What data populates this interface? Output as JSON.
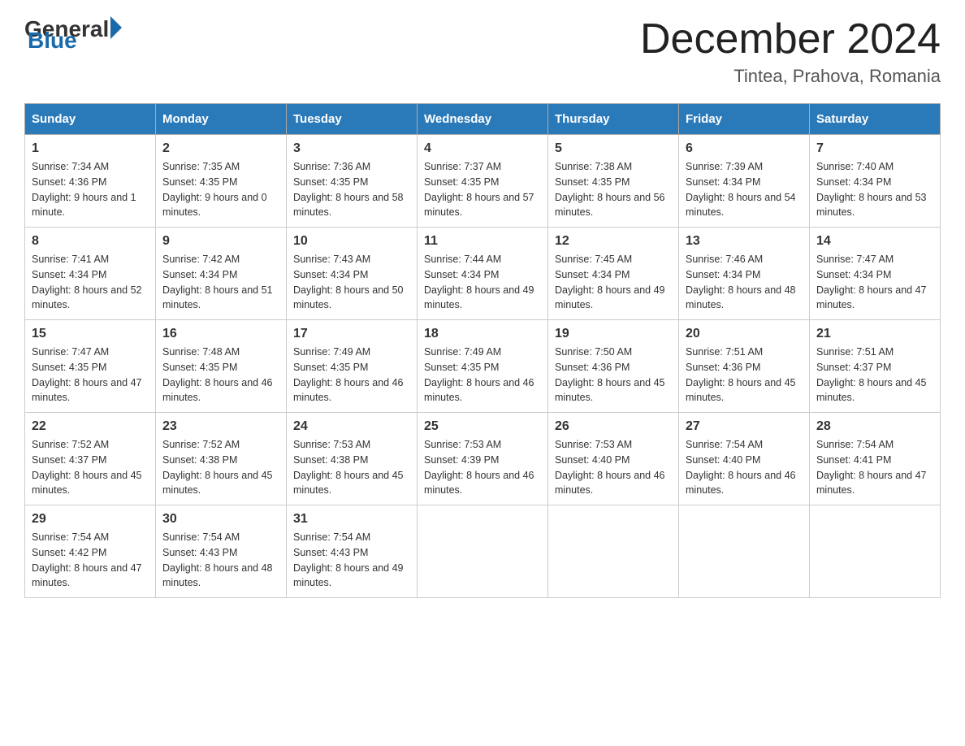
{
  "header": {
    "logo": {
      "general": "General",
      "blue": "Blue"
    },
    "title": "December 2024",
    "location": "Tintea, Prahova, Romania"
  },
  "weekdays": [
    "Sunday",
    "Monday",
    "Tuesday",
    "Wednesday",
    "Thursday",
    "Friday",
    "Saturday"
  ],
  "weeks": [
    [
      {
        "day": "1",
        "sunrise": "7:34 AM",
        "sunset": "4:36 PM",
        "daylight": "9 hours and 1 minute."
      },
      {
        "day": "2",
        "sunrise": "7:35 AM",
        "sunset": "4:35 PM",
        "daylight": "9 hours and 0 minutes."
      },
      {
        "day": "3",
        "sunrise": "7:36 AM",
        "sunset": "4:35 PM",
        "daylight": "8 hours and 58 minutes."
      },
      {
        "day": "4",
        "sunrise": "7:37 AM",
        "sunset": "4:35 PM",
        "daylight": "8 hours and 57 minutes."
      },
      {
        "day": "5",
        "sunrise": "7:38 AM",
        "sunset": "4:35 PM",
        "daylight": "8 hours and 56 minutes."
      },
      {
        "day": "6",
        "sunrise": "7:39 AM",
        "sunset": "4:34 PM",
        "daylight": "8 hours and 54 minutes."
      },
      {
        "day": "7",
        "sunrise": "7:40 AM",
        "sunset": "4:34 PM",
        "daylight": "8 hours and 53 minutes."
      }
    ],
    [
      {
        "day": "8",
        "sunrise": "7:41 AM",
        "sunset": "4:34 PM",
        "daylight": "8 hours and 52 minutes."
      },
      {
        "day": "9",
        "sunrise": "7:42 AM",
        "sunset": "4:34 PM",
        "daylight": "8 hours and 51 minutes."
      },
      {
        "day": "10",
        "sunrise": "7:43 AM",
        "sunset": "4:34 PM",
        "daylight": "8 hours and 50 minutes."
      },
      {
        "day": "11",
        "sunrise": "7:44 AM",
        "sunset": "4:34 PM",
        "daylight": "8 hours and 49 minutes."
      },
      {
        "day": "12",
        "sunrise": "7:45 AM",
        "sunset": "4:34 PM",
        "daylight": "8 hours and 49 minutes."
      },
      {
        "day": "13",
        "sunrise": "7:46 AM",
        "sunset": "4:34 PM",
        "daylight": "8 hours and 48 minutes."
      },
      {
        "day": "14",
        "sunrise": "7:47 AM",
        "sunset": "4:34 PM",
        "daylight": "8 hours and 47 minutes."
      }
    ],
    [
      {
        "day": "15",
        "sunrise": "7:47 AM",
        "sunset": "4:35 PM",
        "daylight": "8 hours and 47 minutes."
      },
      {
        "day": "16",
        "sunrise": "7:48 AM",
        "sunset": "4:35 PM",
        "daylight": "8 hours and 46 minutes."
      },
      {
        "day": "17",
        "sunrise": "7:49 AM",
        "sunset": "4:35 PM",
        "daylight": "8 hours and 46 minutes."
      },
      {
        "day": "18",
        "sunrise": "7:49 AM",
        "sunset": "4:35 PM",
        "daylight": "8 hours and 46 minutes."
      },
      {
        "day": "19",
        "sunrise": "7:50 AM",
        "sunset": "4:36 PM",
        "daylight": "8 hours and 45 minutes."
      },
      {
        "day": "20",
        "sunrise": "7:51 AM",
        "sunset": "4:36 PM",
        "daylight": "8 hours and 45 minutes."
      },
      {
        "day": "21",
        "sunrise": "7:51 AM",
        "sunset": "4:37 PM",
        "daylight": "8 hours and 45 minutes."
      }
    ],
    [
      {
        "day": "22",
        "sunrise": "7:52 AM",
        "sunset": "4:37 PM",
        "daylight": "8 hours and 45 minutes."
      },
      {
        "day": "23",
        "sunrise": "7:52 AM",
        "sunset": "4:38 PM",
        "daylight": "8 hours and 45 minutes."
      },
      {
        "day": "24",
        "sunrise": "7:53 AM",
        "sunset": "4:38 PM",
        "daylight": "8 hours and 45 minutes."
      },
      {
        "day": "25",
        "sunrise": "7:53 AM",
        "sunset": "4:39 PM",
        "daylight": "8 hours and 46 minutes."
      },
      {
        "day": "26",
        "sunrise": "7:53 AM",
        "sunset": "4:40 PM",
        "daylight": "8 hours and 46 minutes."
      },
      {
        "day": "27",
        "sunrise": "7:54 AM",
        "sunset": "4:40 PM",
        "daylight": "8 hours and 46 minutes."
      },
      {
        "day": "28",
        "sunrise": "7:54 AM",
        "sunset": "4:41 PM",
        "daylight": "8 hours and 47 minutes."
      }
    ],
    [
      {
        "day": "29",
        "sunrise": "7:54 AM",
        "sunset": "4:42 PM",
        "daylight": "8 hours and 47 minutes."
      },
      {
        "day": "30",
        "sunrise": "7:54 AM",
        "sunset": "4:43 PM",
        "daylight": "8 hours and 48 minutes."
      },
      {
        "day": "31",
        "sunrise": "7:54 AM",
        "sunset": "4:43 PM",
        "daylight": "8 hours and 49 minutes."
      },
      null,
      null,
      null,
      null
    ]
  ]
}
